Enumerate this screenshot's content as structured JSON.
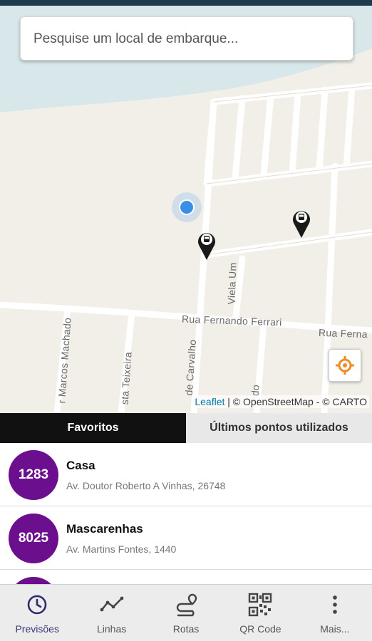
{
  "search": {
    "placeholder": "Pesquise um local de embarque..."
  },
  "map": {
    "streets": {
      "fernando_ferrari_1": "Rua Fernando Ferrari",
      "fernando_ferrari_2": "Rua Ferna",
      "viela_um": "Viela Um",
      "marcos_machado": "r Marcos Machado",
      "teixeira": "sta Teixeira",
      "carvalho": "de Carvalho",
      "do": "do"
    },
    "attribution": {
      "leaflet": "Leaflet",
      "rest": " | © OpenStreetMap - © CARTO"
    },
    "locate_icon": "crosshair-icon",
    "accent_orange": "#f08a24"
  },
  "tabs": [
    {
      "label": "Favoritos",
      "active": true
    },
    {
      "label": "Últimos pontos utilizados",
      "active": false
    }
  ],
  "favorites": [
    {
      "code": "1283",
      "name": "Casa",
      "address": "Av. Doutor Roberto A Vinhas, 26748"
    },
    {
      "code": "8025",
      "name": "Mascarenhas",
      "address": "Av. Martins Fontes, 1440"
    }
  ],
  "badge_color": "#6b0f8f",
  "nav": [
    {
      "label": "Previsões",
      "icon": "clock-icon",
      "active": true
    },
    {
      "label": "Linhas",
      "icon": "trend-line-icon",
      "active": false
    },
    {
      "label": "Rotas",
      "icon": "route-icon",
      "active": false
    },
    {
      "label": "QR Code",
      "icon": "qr-code-icon",
      "active": false
    },
    {
      "label": "Mais...",
      "icon": "more-vertical-icon",
      "active": false
    }
  ]
}
